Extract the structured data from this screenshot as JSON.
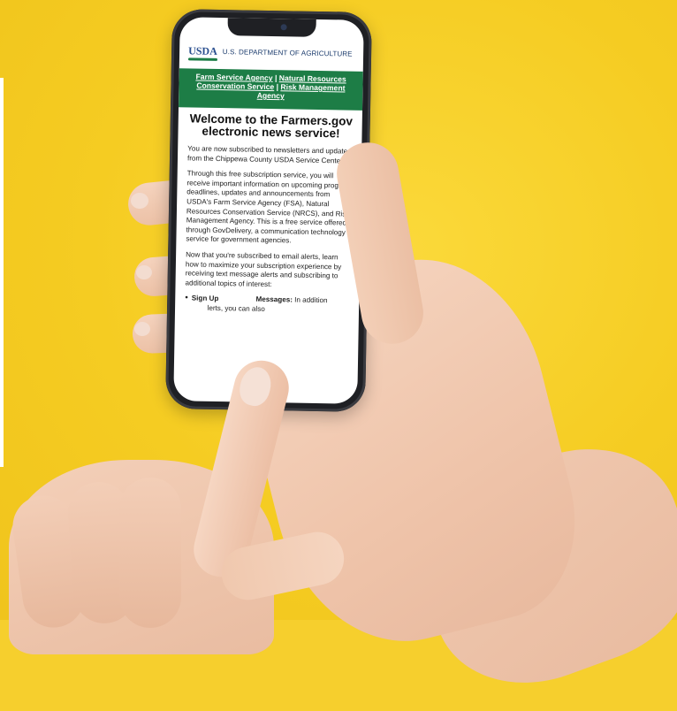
{
  "screen": {
    "usda_logo": "USDA",
    "department": "U.S. DEPARTMENT OF AGRICULTURE",
    "agency_links": {
      "fsa": "Farm Service Agency",
      "sep1": "|",
      "nrcs": "Natural Resources Conservation Service",
      "sep2": "|",
      "rma": "Risk Management Agency"
    },
    "headline": "Welcome to the Farmers.gov electronic news service!",
    "paragraph1": "You are now subscribed to newsletters and updates from the Chippewa County USDA Service Center.",
    "paragraph2": "Through this free subscription service, you will receive important information on upcoming program deadlines, updates and announcements from USDA's Farm Service Agency (FSA), Natural Resources Conservation Service (NRCS), and Risk Management Agency.  This is a free service offered through GovDelivery, a communication technology service for government agencies.",
    "paragraph3": "Now that you're subscribed to email alerts, learn how to maximize your subscription experience by receiving text message alerts and subscribing to additional topics of interest:",
    "bullet_label": "Sign Up",
    "bullet_label_tail": "Messages:",
    "bullet_text": "In addition",
    "bullet_text_tail": "lerts, you can also"
  },
  "colors": {
    "background": "#f6cf2d",
    "usda_green": "#1d7d46",
    "usda_blue": "#2a4f8f"
  }
}
